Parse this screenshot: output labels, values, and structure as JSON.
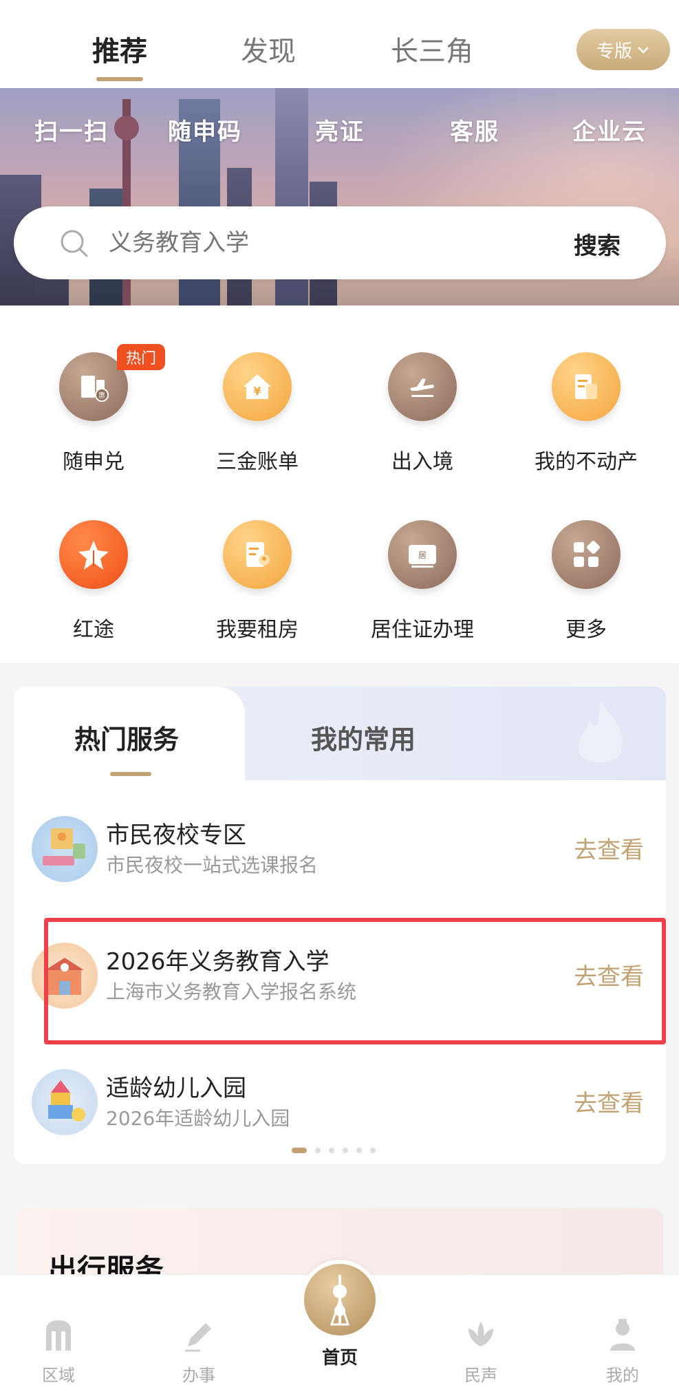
{
  "top_tabs": {
    "tab1": "推荐",
    "tab2": "发现",
    "tab3": "长三角",
    "edition": "专版"
  },
  "quick_links": [
    "扫一扫",
    "随申码",
    "亮证",
    "客服",
    "企业云"
  ],
  "search": {
    "placeholder": "义务教育入学",
    "button": "搜索"
  },
  "grid": {
    "hot_badge": "热门",
    "items": [
      "随申兑",
      "三金账单",
      "出入境",
      "我的不动产",
      "红途",
      "我要租房",
      "居住证办理",
      "更多"
    ]
  },
  "services": {
    "tab_hot": "热门服务",
    "tab_mine": "我的常用",
    "rows": [
      {
        "title": "市民夜校专区",
        "subtitle": "市民夜校一站式选课报名",
        "action": "去查看"
      },
      {
        "title": "2026年义务教育入学",
        "subtitle": "上海市义务教育入学报名系统",
        "action": "去查看"
      },
      {
        "title": "适龄幼儿入园",
        "subtitle": "2026年适龄幼儿入园",
        "action": "去查看"
      }
    ]
  },
  "travel": {
    "title": "出行服务"
  },
  "bottom_nav": [
    "区域",
    "办事",
    "首页",
    "民声",
    "我的"
  ]
}
